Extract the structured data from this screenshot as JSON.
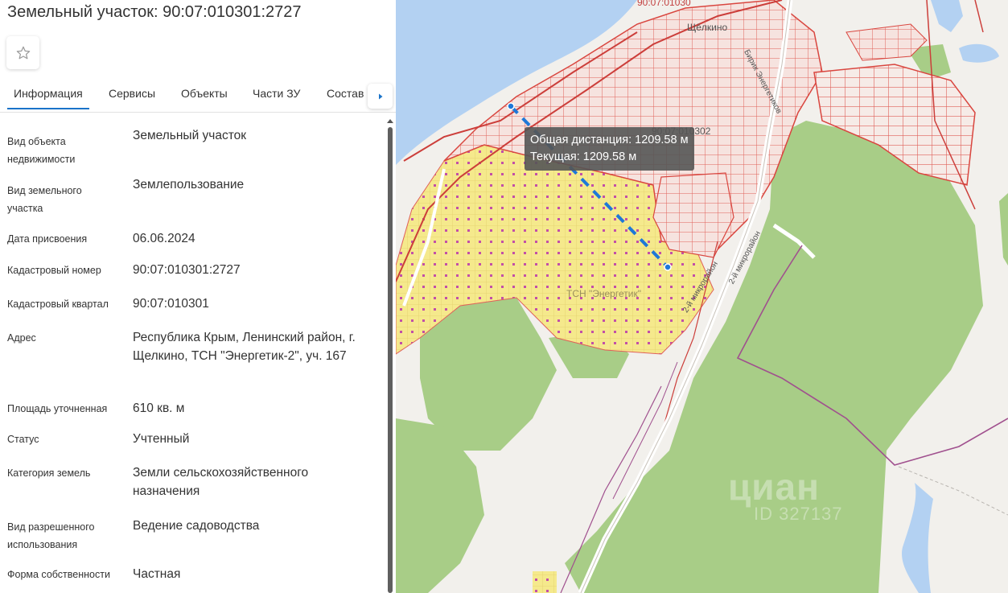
{
  "panel": {
    "title": "Земельный участок: 90:07:010301:2727",
    "tabs": [
      {
        "label": "Информация",
        "active": true
      },
      {
        "label": "Сервисы"
      },
      {
        "label": "Объекты"
      },
      {
        "label": "Части ЗУ"
      },
      {
        "label": "Состав"
      }
    ],
    "rows": [
      {
        "label": "Вид объекта недвижимости",
        "value": "Земельный участок"
      },
      {
        "label": "Вид земельного участка",
        "value": "Землепользование"
      },
      {
        "label": "Дата присвоения",
        "value": "06.06.2024"
      },
      {
        "label": "Кадастровый номер",
        "value": "90:07:010301:2727"
      },
      {
        "label": "Кадастровый квартал",
        "value": "90:07:010301"
      },
      {
        "label": "Адрес",
        "value": "Республика Крым, Ленинский район, г. Щелкино, ТСН \"Энергетик-2\", уч. 167"
      },
      {
        "label": "Площадь уточненная",
        "value": "610 кв. м"
      },
      {
        "label": "Статус",
        "value": "Учтенный"
      },
      {
        "label": "Категория земель",
        "value": "Земли сельскохозяйственного назначения"
      },
      {
        "label": "Вид разрешенного использования",
        "value": "Ведение садоводства"
      },
      {
        "label": "Форма собственности",
        "value": "Частная"
      }
    ]
  },
  "map": {
    "tooltip": {
      "total": "Общая дистанция: 1209.58 м",
      "current": "Текущая: 1209.58 м"
    },
    "labels": {
      "town": "Щёлкино",
      "quarter": "90:07:010302",
      "top_quarter": "90:07:01030",
      "tsn": "ТСН \"Энергетик\"",
      "street1": "2-й микрорайон",
      "street2": "2-й микрорайон",
      "street3": "Бирик Энергетиков"
    },
    "watermark": {
      "brand": "циан",
      "id": "ID 327137"
    },
    "colors": {
      "sea": "#b3d1f2",
      "forest": "#a8cd87",
      "garden": "#f5e98c",
      "parcel_line": "#e0605a",
      "measure_line": "#1e78d8"
    }
  },
  "icons": {
    "favorite": "star-icon",
    "next": "chevron-right-icon"
  }
}
